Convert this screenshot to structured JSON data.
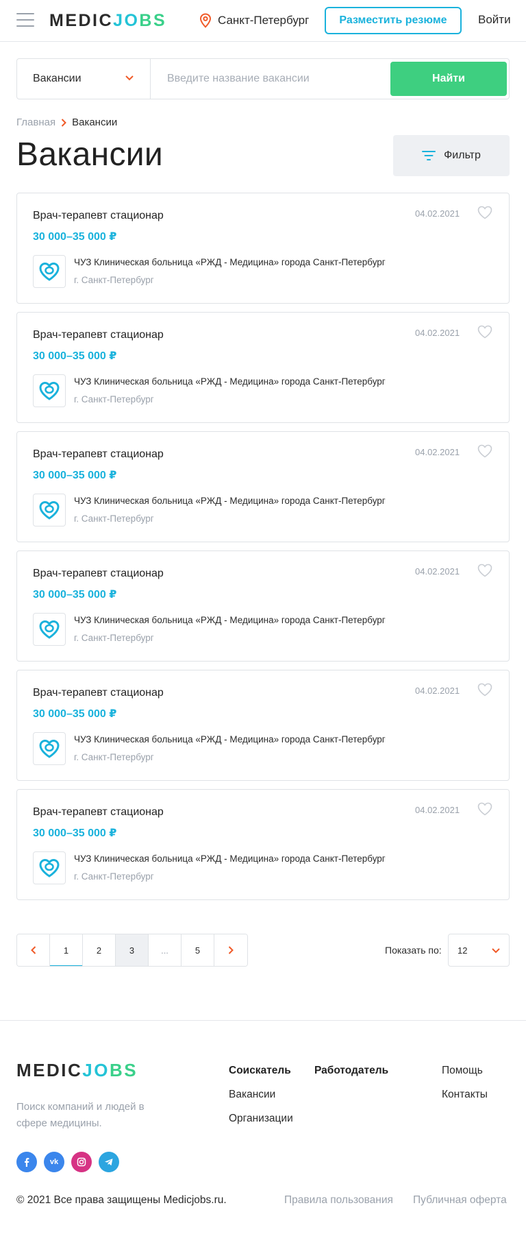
{
  "header": {
    "logo": {
      "part1": "MEDIC",
      "part2": "JO",
      "part3": "BS"
    },
    "city": "Санкт-Петербург",
    "resume_button": "Разместить резюме",
    "login": "Войти"
  },
  "search": {
    "category": "Вакансии",
    "placeholder": "Введите название вакансии",
    "find_button": "Найти"
  },
  "breadcrumb": {
    "home": "Главная",
    "current": "Вакансии"
  },
  "page_title": "Вакансии",
  "filter_button": "Фильтр",
  "vacancies": [
    {
      "title": "Врач-терапевт стационар",
      "salary": "30 000–35 000 ₽",
      "date": "04.02.2021",
      "org": "ЧУЗ Клиническая больница «РЖД - Медицина» города Санкт-Петербург",
      "city": "г. Санкт-Петербург"
    },
    {
      "title": "Врач-терапевт стационар",
      "salary": "30 000–35 000 ₽",
      "date": "04.02.2021",
      "org": "ЧУЗ Клиническая больница «РЖД - Медицина» города Санкт-Петербург",
      "city": "г. Санкт-Петербург"
    },
    {
      "title": "Врач-терапевт стационар",
      "salary": "30 000–35 000 ₽",
      "date": "04.02.2021",
      "org": "ЧУЗ Клиническая больница «РЖД - Медицина» города Санкт-Петербург",
      "city": "г. Санкт-Петербург"
    },
    {
      "title": "Врач-терапевт стационар",
      "salary": "30 000–35 000 ₽",
      "date": "04.02.2021",
      "org": "ЧУЗ Клиническая больница «РЖД - Медицина» города Санкт-Петербург",
      "city": "г. Санкт-Петербург"
    },
    {
      "title": "Врач-терапевт стационар",
      "salary": "30 000–35 000 ₽",
      "date": "04.02.2021",
      "org": "ЧУЗ Клиническая больница «РЖД - Медицина» города Санкт-Петербург",
      "city": "г. Санкт-Петербург"
    },
    {
      "title": "Врач-терапевт стационар",
      "salary": "30 000–35 000 ₽",
      "date": "04.02.2021",
      "org": "ЧУЗ Клиническая больница «РЖД - Медицина» города Санкт-Петербург",
      "city": "г. Санкт-Петербург"
    }
  ],
  "pagination": {
    "pages": [
      "1",
      "2",
      "3",
      "...",
      "5"
    ],
    "active_page": "1",
    "current_page": "3",
    "show_label": "Показать по:",
    "per_page": "12"
  },
  "footer": {
    "tagline": "Поиск компаний и людей в сфере медицины.",
    "col1": {
      "heading": "Соискатель",
      "links": [
        "Вакансии",
        "Организации"
      ]
    },
    "col2": {
      "heading": "Работодатель"
    },
    "col3": {
      "links": [
        "Помощь",
        "Контакты"
      ]
    },
    "social": [
      "facebook-icon",
      "vk-icon",
      "instagram-icon",
      "telegram-icon"
    ],
    "copyright": "© 2021 Все права защищены Medicjobs.ru.",
    "terms": "Правила пользования",
    "offer": "Публичная оферта"
  },
  "colors": {
    "accent_blue": "#1ab2dc",
    "accent_green": "#3ecf80",
    "logo_teal": "#24c3d6",
    "icon_orange": "#f05a28"
  }
}
